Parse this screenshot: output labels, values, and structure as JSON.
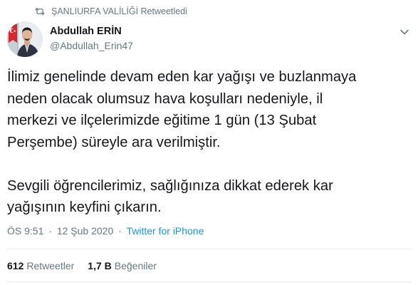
{
  "retweet_context": {
    "text": "ŞANLIURFA VALİLİĞİ Retweetledi",
    "icon": "retweet-icon"
  },
  "author": {
    "name": "Abdullah ERİN",
    "handle": "@Abdullah_Erin47",
    "avatar": "profile-photo"
  },
  "menu_icon": "chevron-down-icon",
  "tweet": {
    "paragraphs": [
      "İlimiz genelinde devam eden kar yağışı ve buzlanmaya\nneden olacak olumsuz hava koşulları nedeniyle, il\nmerkezi ve ilçelerimizde eğitime 1 gün (13 Şubat\nPerşembe) süreyle ara verilmiştir.",
      "Sevgili öğrencilerimiz, sağlığınıza dikkat ederek kar\nyağışının keyfini çıkarın."
    ]
  },
  "meta": {
    "time": "ÖS 9:51",
    "separator": "·",
    "date": "12 Şub 2020",
    "source": "Twitter for iPhone"
  },
  "stats": {
    "retweets": {
      "count": "612",
      "label": "Retweetler"
    },
    "likes": {
      "count": "1,7 B",
      "label": "Beğeniler"
    }
  },
  "colors": {
    "text": "#14171a",
    "secondary": "#657786",
    "link": "#1b95e0",
    "divider": "#e6ecf0"
  }
}
